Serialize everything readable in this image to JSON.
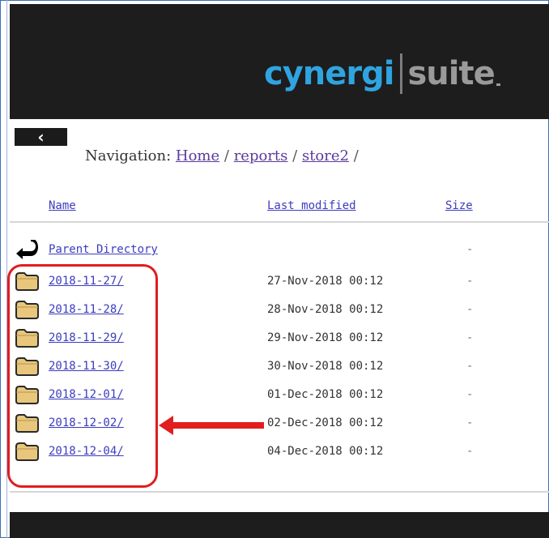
{
  "header": {
    "logo_text_1": "cynergi",
    "logo_text_2": "suite",
    "logo_colors": {
      "cynergi": "#2fa4e0",
      "suite": "#9a9a9a"
    },
    "background": "#1d1d1d"
  },
  "back_button": {
    "label": "‹",
    "icon": "chevron-left-icon"
  },
  "navigation": {
    "label": "Navigation:",
    "crumbs": [
      "Home",
      "reports",
      "store2"
    ],
    "separator": "/"
  },
  "table": {
    "headers": {
      "name": "Name",
      "modified": "Last modified",
      "size": "Size"
    },
    "parent": {
      "name": "Parent Directory",
      "modified": "",
      "size": "-",
      "icon": "back-arrow-icon"
    },
    "rows": [
      {
        "name": "2018-11-27/",
        "modified": "27-Nov-2018 00:12",
        "size": "-",
        "icon": "folder-icon"
      },
      {
        "name": "2018-11-28/",
        "modified": "28-Nov-2018 00:12",
        "size": "-",
        "icon": "folder-icon"
      },
      {
        "name": "2018-11-29/",
        "modified": "29-Nov-2018 00:12",
        "size": "-",
        "icon": "folder-icon"
      },
      {
        "name": "2018-11-30/",
        "modified": "30-Nov-2018 00:12",
        "size": "-",
        "icon": "folder-icon"
      },
      {
        "name": "2018-12-01/",
        "modified": "01-Dec-2018 00:12",
        "size": "-",
        "icon": "folder-icon"
      },
      {
        "name": "2018-12-02/",
        "modified": "02-Dec-2018 00:12",
        "size": "-",
        "icon": "folder-icon"
      },
      {
        "name": "2018-12-04/",
        "modified": "04-Dec-2018 00:12",
        "size": "-",
        "icon": "folder-icon"
      }
    ]
  },
  "annotation": {
    "highlight_color": "#e11d1d",
    "arrow_icon": "red-arrow-icon"
  }
}
